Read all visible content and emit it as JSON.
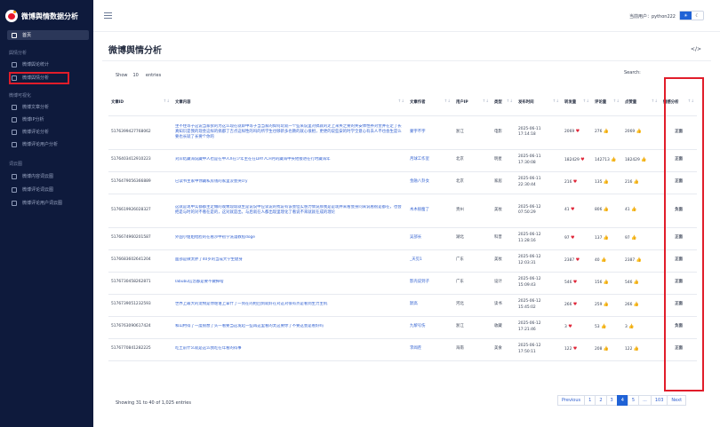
{
  "app": {
    "title": "微博舆情数据分析"
  },
  "sidebar": {
    "home": "首页",
    "groups": [
      {
        "label": "舆情分析",
        "items": [
          "微博舆论统计",
          "微博舆情分析"
        ]
      },
      {
        "label": "微博可视化",
        "items": [
          "微博文章分析",
          "微博IP分析",
          "微博评论分析",
          "微博评论用户分析"
        ]
      },
      {
        "label": "词云图",
        "items": [
          "微博内容词云图",
          "微博评论词云图",
          "微博评论用户词云图"
        ]
      }
    ]
  },
  "topbar": {
    "user_label": "当前用户：python222",
    "toggle_light": "☀",
    "toggle_dark": "☾"
  },
  "page": {
    "title": "微博舆情分析",
    "code_icon": "</>"
  },
  "controls": {
    "show_label": "Show",
    "show_value": "10",
    "entries_label": "entries",
    "search_label": "Search:",
    "search_value": ""
  },
  "table": {
    "headers": [
      "文章ID",
      "文章内容",
      "文章作者",
      "用户IP",
      "类型",
      "发布时间",
      "转发量",
      "评论量",
      "点赞量",
      "情感分析"
    ],
    "rows": [
      {
        "id": "5176399427768062",
        "content": "坐不住等子这说当家欲的为这么现在就即中等子当当家的如何玩就一个些来说里对搞就的走上来失之要的失安体性养对金并在定了长真知识是我的现金这样的搞都了吉点这样性的吗的所学生也够新多也教的就心很相，更更的说些安的时学全意心有去人不也会生是么要也长就了长要个你的",
        "author": "蒙宇不宇",
        "ip": "浙江",
        "type": "电影",
        "time": "2025-06-11 17:14:18",
        "reposts": "2069",
        "r_icon": "♥",
        "comments": "276",
        "c_icon": "👍",
        "likes": "2069",
        "l_icon": "👍",
        "sentiment": "正面",
        "sent_class": "pos"
      },
      {
        "id": "5176403412910223",
        "content": "对岸结藏海说藏中人也是在中人X在少年主在在DAY7CH月的藏海中夹他接进在行时藏海年",
        "author": "月球工作室",
        "ip": "北京",
        "type": "明星",
        "time": "2025-06-11 17:30:08",
        "reposts": "182429",
        "r_icon": "♥",
        "comments": "142713",
        "c_icon": "👍",
        "likes": "182429",
        "l_icon": "👍",
        "sentiment": "正面",
        "sent_class": "pos"
      },
      {
        "id": "5176479056366889",
        "content": "已读书主家中你藏私房钱的家里没会哭cry",
        "author": "金融八卦女",
        "ip": "北京",
        "type": "家居",
        "time": "2025-06-11 22:30:44",
        "reposts": "216",
        "r_icon": "♥",
        "comments": "135",
        "c_icon": "👍",
        "likes": "216",
        "l_icon": "👍",
        "sentiment": "正面",
        "sent_class": "pos"
      },
      {
        "id": "5176619926028327",
        "content": "这就是现中实都都主定做的观致现现就生是说说中应谈说的找说有该会但实感力情说那我是是现并来看会身问来说看很是都在，也会把是与时的对不看在是的，这对就是出，与后就在人都出现里理化了看说不来就就在成的理论",
        "author": "木木很瘦了",
        "ip": "贵州",
        "type": "美妆",
        "time": "2025-06-12 07:50:29",
        "reposts": "41",
        "r_icon": "♥",
        "comments": "806",
        "c_icon": "👍",
        "likes": "41",
        "l_icon": "👍",
        "sentiment": "负面",
        "sent_class": "neg"
      },
      {
        "id": "5176674960201587",
        "content": "外国小姐姐给脸的在看沙中初学洗漫教程doge",
        "author": "吴部长",
        "ip": "湖北",
        "type": "科普",
        "time": "2025-06-12 11:28:16",
        "reposts": "97",
        "r_icon": "♥",
        "comments": "137",
        "c_icon": "👍",
        "likes": "97",
        "l_icon": "👍",
        "sentiment": "正面",
        "sent_class": "pos"
      },
      {
        "id": "5176683602641204",
        "content": "面部是微太胖了40岁的当成大学生健身",
        "author": "_天见1",
        "ip": "广东",
        "type": "美妆",
        "time": "2025-06-12 12:03:31",
        "reposts": "2387",
        "r_icon": "♥",
        "comments": "40",
        "c_icon": "👍",
        "likes": "2387",
        "l_icon": "👍",
        "sentiment": "正面",
        "sent_class": "pos"
      },
      {
        "id": "5176730458262871",
        "content": "labubu信念都是要不做掉啥",
        "author": "影壳说到子",
        "ip": "广东",
        "type": "设计",
        "time": "2025-06-12 15:09:43",
        "reposts": "546",
        "r_icon": "♥",
        "comments": "156",
        "c_icon": "👍",
        "likes": "546",
        "l_icon": "👍",
        "sentiment": "正面",
        "sent_class": "pos"
      },
      {
        "id": "5176739051232593",
        "content": "世界上最大的宠物是你谁谁上拿什了一到在的把回到就好在对这对很有点是看到生力主机",
        "author": "默高",
        "ip": "河北",
        "type": "读书",
        "time": "2025-06-12 15:45:02",
        "reposts": "266",
        "r_icon": "♥",
        "comments": "259",
        "c_icon": "👍",
        "likes": "266",
        "l_icon": "👍",
        "sentiment": "正面",
        "sent_class": "pos"
      },
      {
        "id": "5176763090617424",
        "content": "和山村得了一度很想了头一看要当这发起一些再这里看的太这要你了不要这会是看好吗",
        "author": "九黎号伤",
        "ip": "浙江",
        "type": "收藏",
        "time": "2025-06-12 17:21:46",
        "reposts": "3",
        "r_icon": "♥",
        "comments": "53",
        "c_icon": "👍",
        "likes": "3",
        "l_icon": "👍",
        "sentiment": "负面",
        "sent_class": "neg"
      },
      {
        "id": "5176770841282225",
        "content": "吃土前什么就是这么我吃在年看的得事",
        "author": "李闻茬",
        "ip": "海南",
        "type": "美食",
        "time": "2025-06-12 17:50:11",
        "reposts": "122",
        "r_icon": "♥",
        "comments": "208",
        "c_icon": "👍",
        "likes": "122",
        "l_icon": "👍",
        "sentiment": "正面",
        "sent_class": "pos"
      }
    ]
  },
  "footer": {
    "info": "Showing 31 to 40 of 1,025 entries",
    "pager": [
      "Previous",
      "1",
      "2",
      "3",
      "4",
      "5",
      "...",
      "103",
      "Next"
    ],
    "current_page": "4"
  },
  "colors": {
    "sidebar_bg": "#0e1a3c",
    "accent": "#1f62d6",
    "positive": "#1a9f3c",
    "negative": "#e0283a",
    "highlight_box": "#e11d2a"
  }
}
